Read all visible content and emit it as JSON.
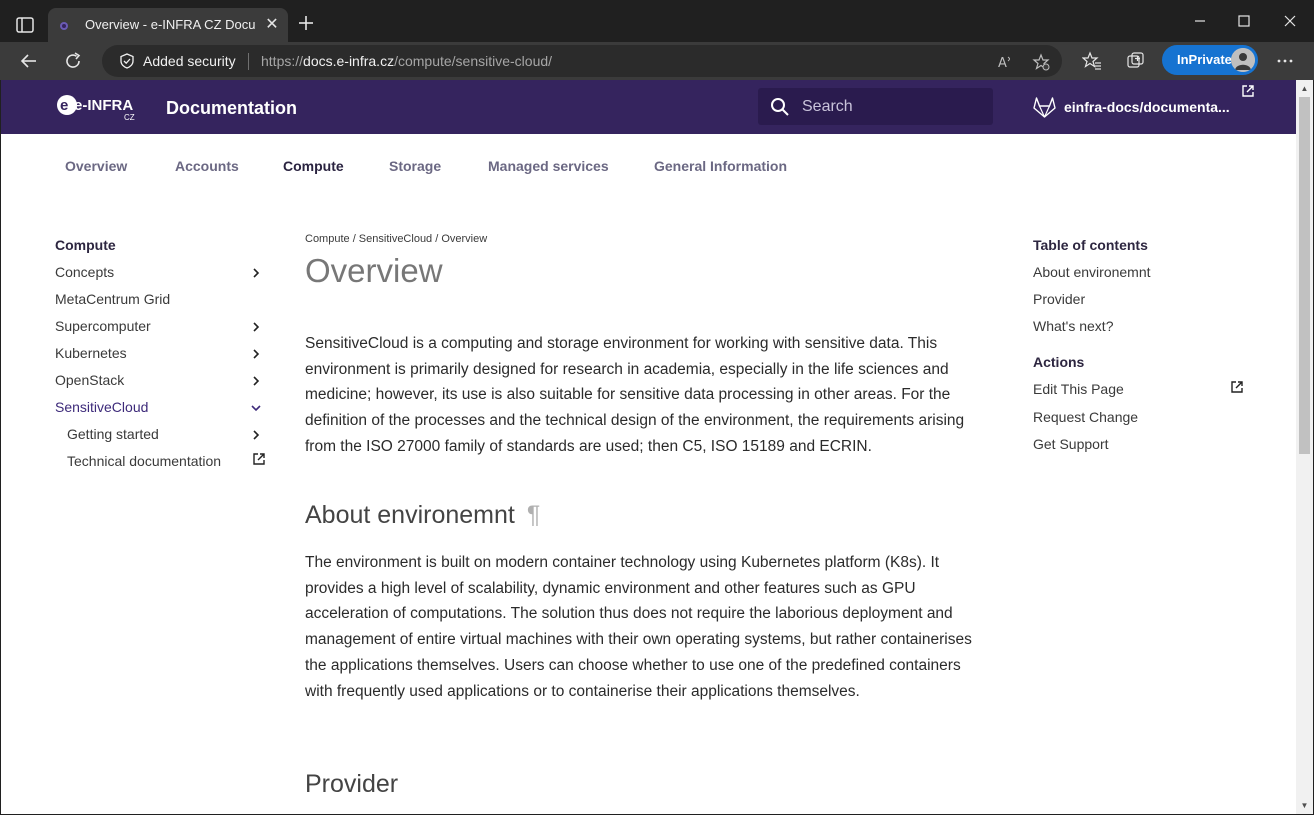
{
  "browser": {
    "tab_title": "Overview - e-INFRA CZ Documentation",
    "security_label": "Added security",
    "url_prefix": "https://",
    "url_host": "docs.e-infra.cz",
    "url_path": "/compute/sensitive-cloud/",
    "inprivate_label": "InPrivate"
  },
  "header": {
    "logo_text": "e-INFRA",
    "logo_sub": "CZ",
    "site_title": "Documentation",
    "search_placeholder": "Search",
    "repo_name": "einfra-docs/documenta..."
  },
  "nav_tabs": [
    "Overview",
    "Accounts",
    "Compute",
    "Storage",
    "Managed services",
    "General Information"
  ],
  "active_tab": "Compute",
  "sidebar": {
    "title": "Compute",
    "items": [
      {
        "label": "Concepts",
        "chevron": "right"
      },
      {
        "label": "MetaCentrum Grid",
        "chevron": ""
      },
      {
        "label": "Supercomputer",
        "chevron": "right"
      },
      {
        "label": "Kubernetes",
        "chevron": "right"
      },
      {
        "label": "OpenStack",
        "chevron": "right"
      },
      {
        "label": "SensitiveCloud",
        "chevron": "down"
      },
      {
        "label": "Getting started",
        "chevron": "right"
      },
      {
        "label": "Technical documentation",
        "chevron": "external"
      }
    ]
  },
  "content": {
    "breadcrumb": "Compute / SensitiveCloud / Overview",
    "title": "Overview",
    "intro": "SensitiveCloud is a computing and storage environment for working with sensitive data. This environment is primarily designed for research in academia, especially in the life sciences and medicine; however, its use is also suitable for sensitive data processing in other areas. For the definition of the processes and the technical design of the environment, the requirements arising from the ISO 27000 family of standards are used; then C5, ISO 15189 and ECRIN.",
    "section1_title": "About environemnt",
    "pilcrow": "¶",
    "section1_text": "The environment is built on modern container technology using Kubernetes platform (K8s). It provides a high level of scalability, dynamic environment and other features such as GPU acceleration of computations. The solution thus does not require the laborious deployment and management of entire virtual machines with their own operating systems, but rather containerises the applications themselves. Users can choose whether to use one of the predefined containers with frequently used applications or to containerise their applications themselves.",
    "section2_title": "Provider"
  },
  "toc": {
    "title": "Table of contents",
    "items": [
      "About environemnt",
      "Provider",
      "What's next?"
    ],
    "actions_title": "Actions",
    "actions": [
      "Edit This Page",
      "Request Change",
      "Get Support"
    ]
  }
}
